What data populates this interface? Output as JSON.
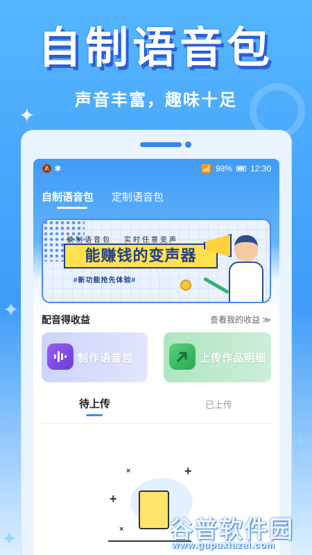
{
  "promo": {
    "title": "自制语音包",
    "subtitle": "声音丰富，趣味十足"
  },
  "statusbar": {
    "left_icons": "🔕 ✱",
    "signal": "📶",
    "battery_percent": "98%",
    "time": "12:30"
  },
  "tabs": [
    {
      "label": "自制语音包",
      "active": true
    },
    {
      "label": "定制语音包",
      "active": false
    }
  ],
  "banner": {
    "tag_1": "录制语音包",
    "tag_2": "实时任意变声",
    "headline": "能赚钱的变声器",
    "subtag": "#新功能抢先体验#"
  },
  "earnings": {
    "title": "配音得收益",
    "link": "查看我的收益 ≫"
  },
  "cards": [
    {
      "label": "制作语音包",
      "icon": "waveform-icon",
      "color": "#7b4be0"
    },
    {
      "label": "上传作品明细",
      "icon": "upload-arrow-icon",
      "color": "#2fb05a"
    }
  ],
  "sub_tabs": [
    {
      "label": "待上传",
      "active": true
    },
    {
      "label": "已上传",
      "active": false
    }
  ],
  "watermark": {
    "name": "谷普软件园",
    "url": "www.gupuxiazai.com"
  },
  "colors": {
    "accent": "#3f8ff0",
    "background": "#55b6ff"
  }
}
